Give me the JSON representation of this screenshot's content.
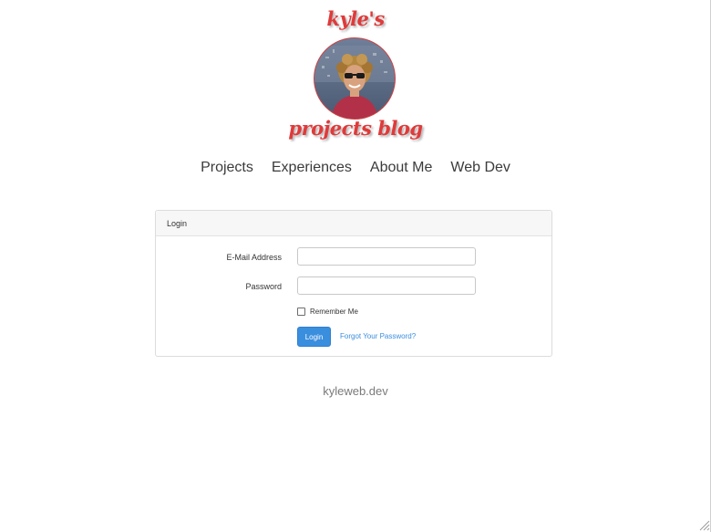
{
  "brand": {
    "line1": "kyle's",
    "line2": "projects blog",
    "color": "#e03a3a"
  },
  "avatar": {
    "icon": "profile-photo"
  },
  "nav": {
    "items": [
      {
        "label": "Projects"
      },
      {
        "label": "Experiences"
      },
      {
        "label": "About Me"
      },
      {
        "label": "Web Dev"
      }
    ]
  },
  "login_card": {
    "header": "Login",
    "email": {
      "label": "E-Mail Address",
      "value": "",
      "placeholder": ""
    },
    "password": {
      "label": "Password",
      "value": "",
      "placeholder": ""
    },
    "remember": {
      "label": "Remember Me",
      "checked": false
    },
    "submit_label": "Login",
    "forgot_label": "Forgot Your Password?",
    "accent_color": "#3a8ede"
  },
  "footer": {
    "text": "kyleweb.dev"
  }
}
